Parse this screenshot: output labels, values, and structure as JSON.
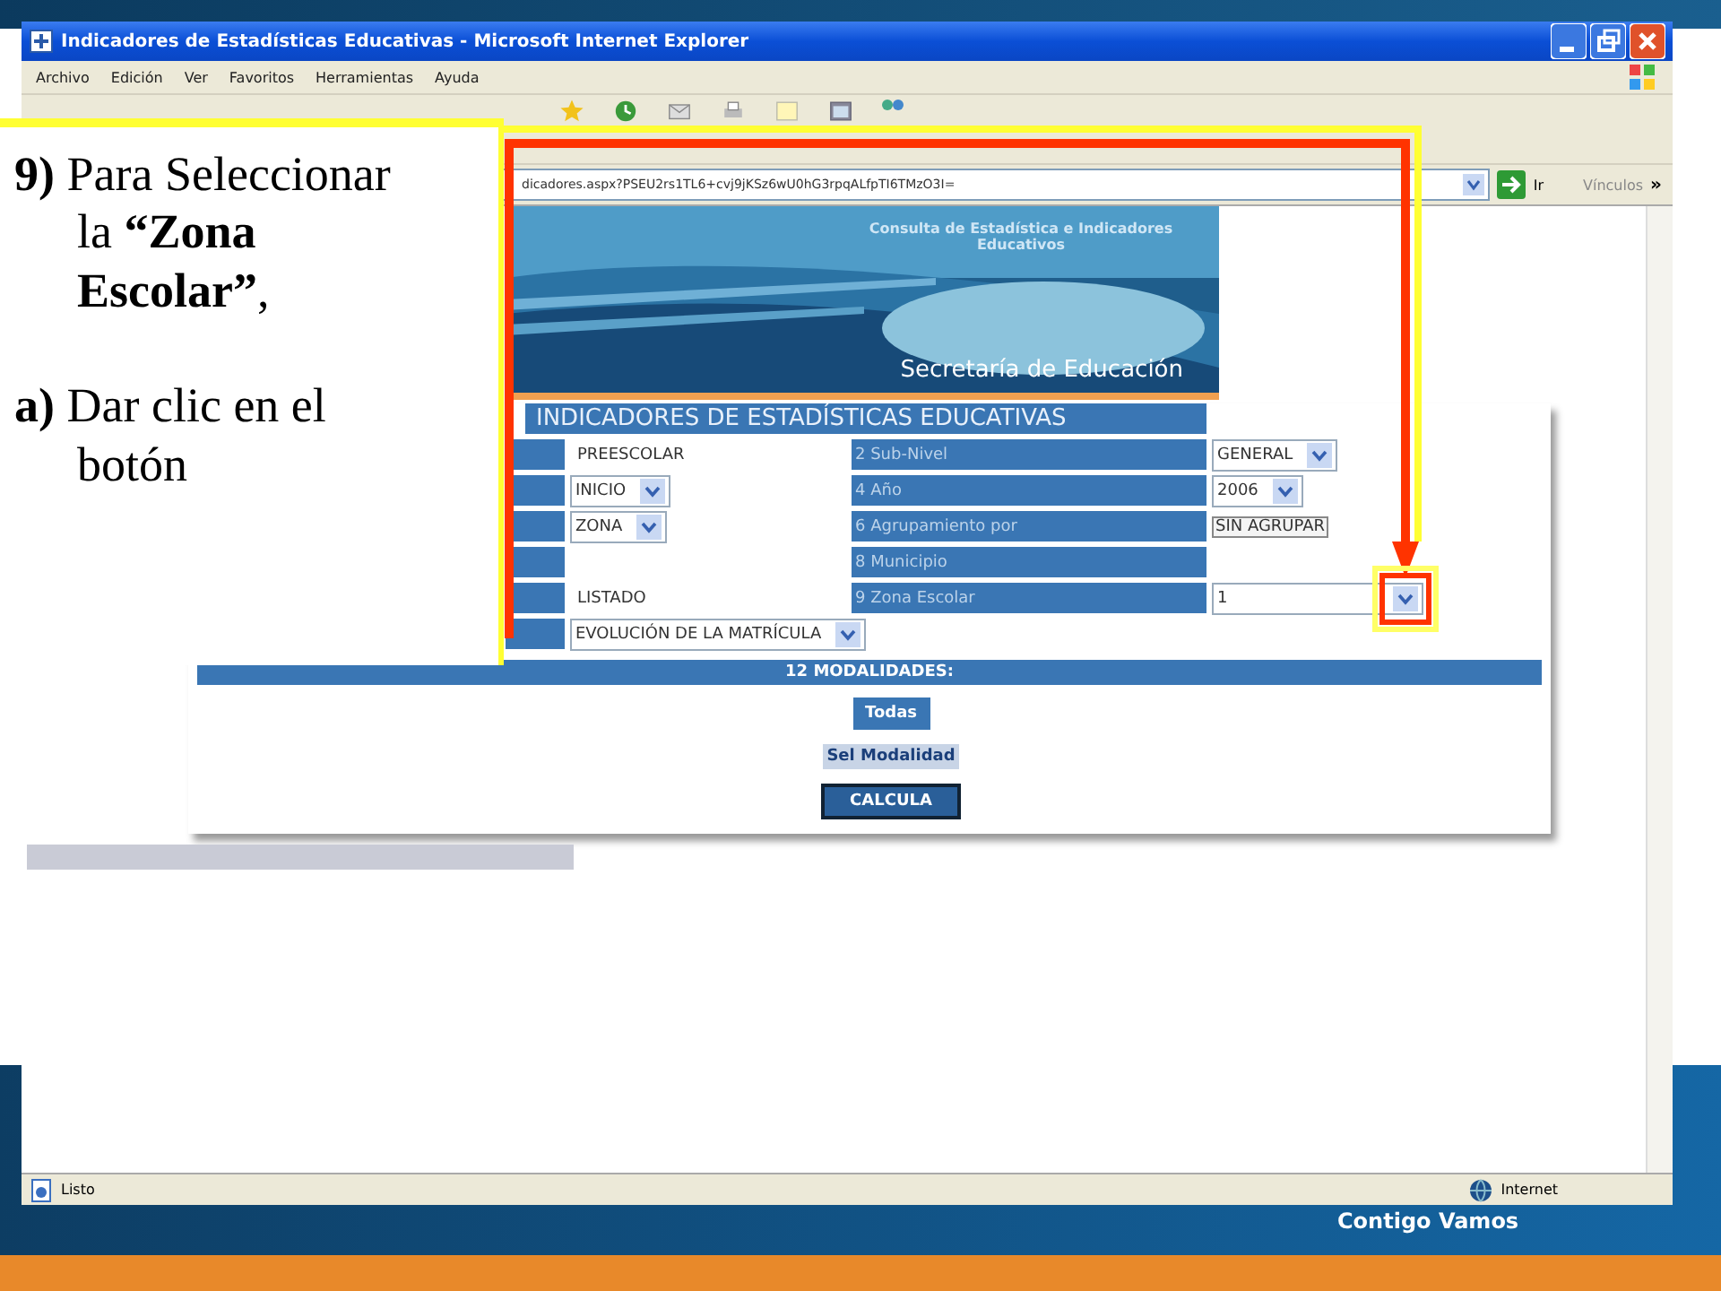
{
  "window": {
    "title": "Indicadores de Estadísticas Educativas - Microsoft Internet Explorer"
  },
  "menu": [
    "Archivo",
    "Edición",
    "Ver",
    "Favoritos",
    "Herramientas",
    "Ayuda"
  ],
  "address_bar": {
    "value": "dicadores.aspx?PSEU2rs1TL6+cvj9jKSz6wU0hG3rpqALfpTI6TMzO3I=",
    "go_label": "Ir",
    "links_label": "Vínculos",
    "more": "»"
  },
  "banner": {
    "heading": "Consulta de Estadística e Indicadores Educativos",
    "subtitle": "Secretaría de Educación"
  },
  "form": {
    "title": "INDICADORES DE ESTADÍSTICAS EDUCATIVAS",
    "rows": [
      {
        "left": {
          "kind": "text",
          "value": "PREESCOLAR"
        },
        "label": "2 Sub-Nivel",
        "right": {
          "kind": "select",
          "value": "GENERAL"
        }
      },
      {
        "left": {
          "kind": "select",
          "value": "INICIO"
        },
        "label": "4 Año",
        "right": {
          "kind": "select",
          "value": "2006"
        }
      },
      {
        "left": {
          "kind": "select",
          "value": "ZONA"
        },
        "label": "6 Agrupamiento por",
        "right": {
          "kind": "button",
          "value": "SIN AGRUPAR"
        }
      },
      {
        "left": {
          "kind": "empty"
        },
        "label": "8 Municipio",
        "right": {
          "kind": "empty"
        }
      },
      {
        "left": {
          "kind": "text",
          "value": "LISTADO"
        },
        "label": "9 Zona Escolar",
        "right": {
          "kind": "select",
          "value": "1",
          "highlighted": true
        }
      },
      {
        "left": {
          "kind": "select",
          "value": "EVOLUCIÓN DE LA MATRÍCULA"
        }
      }
    ],
    "section": "12 MODALIDADES:",
    "buttons": [
      {
        "label": "Todas",
        "kind": "primary"
      },
      {
        "label": "Sel Modalidad",
        "kind": "secondary"
      },
      {
        "label": "CALCULA",
        "kind": "dark"
      }
    ]
  },
  "callout": {
    "paragraphs": [
      "**9)** Para Seleccionar la **“Zona Escolar”**,",
      "**a)** Dar clic en el botón"
    ]
  },
  "status_bar": {
    "text": "Listo",
    "zone": "Internet"
  },
  "slide": {
    "footer": "Contigo Vamos"
  }
}
